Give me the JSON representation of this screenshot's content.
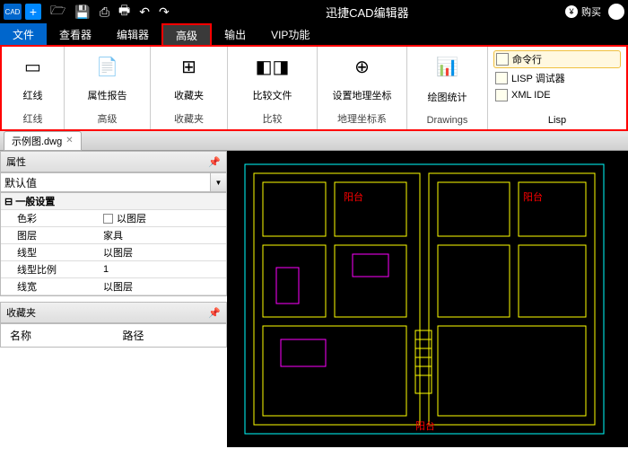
{
  "title": "迅捷CAD编辑器",
  "buy": "购买",
  "menus": {
    "file": "文件",
    "viewer": "查看器",
    "editor": "编辑器",
    "advanced": "高级",
    "output": "输出",
    "vip": "VIP功能"
  },
  "ribbon": {
    "redline": {
      "lbl": "红线",
      "grp": "红线"
    },
    "attr": {
      "lbl": "属性报告",
      "grp": "高级"
    },
    "fav": {
      "lbl": "收藏夹",
      "grp": "收藏夹"
    },
    "cmp": {
      "lbl": "比较文件",
      "grp": "比较"
    },
    "geo": {
      "lbl": "设置地理坐标",
      "grp": "地理坐标系"
    },
    "stat": {
      "lbl": "绘图统计",
      "grp": "Drawings"
    },
    "lisp": {
      "cmd": "命令行",
      "dbg": "LISP 调试器",
      "ide": "XML IDE",
      "grp": "Lisp"
    }
  },
  "doc": "示例图.dwg",
  "props": {
    "title": "属性",
    "default": "默认值",
    "general": "一般设置",
    "rows": [
      {
        "k": "色彩",
        "v": "以图层",
        "chk": true
      },
      {
        "k": "图层",
        "v": "家具"
      },
      {
        "k": "线型",
        "v": "以图层"
      },
      {
        "k": "线型比例",
        "v": "1"
      },
      {
        "k": "线宽",
        "v": "以图层"
      }
    ]
  },
  "fav": {
    "title": "收藏夹",
    "c1": "名称",
    "c2": "路径"
  }
}
